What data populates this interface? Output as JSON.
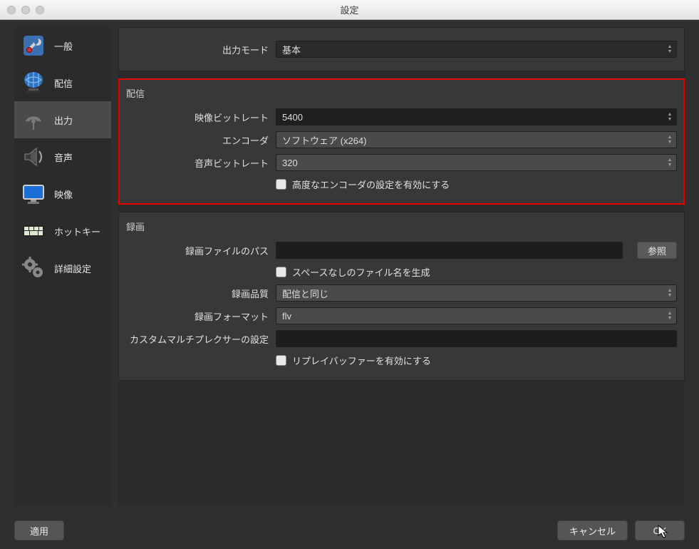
{
  "window": {
    "title": "設定"
  },
  "sidebar": {
    "items": [
      {
        "label": "一般"
      },
      {
        "label": "配信"
      },
      {
        "label": "出力"
      },
      {
        "label": "音声"
      },
      {
        "label": "映像"
      },
      {
        "label": "ホットキー"
      },
      {
        "label": "詳細設定"
      }
    ]
  },
  "output_mode": {
    "label": "出力モード",
    "value": "基本"
  },
  "streaming": {
    "title": "配信",
    "video_bitrate_label": "映像ビットレート",
    "video_bitrate_value": "5400",
    "encoder_label": "エンコーダ",
    "encoder_value": "ソフトウェア (x264)",
    "audio_bitrate_label": "音声ビットレート",
    "audio_bitrate_value": "320",
    "advanced_encoder_checkbox": "高度なエンコーダの設定を有効にする"
  },
  "recording": {
    "title": "録画",
    "path_label": "録画ファイルのパス",
    "path_value": "",
    "browse_label": "参照",
    "no_space_checkbox": "スペースなしのファイル名を生成",
    "quality_label": "録画品質",
    "quality_value": "配信と同じ",
    "format_label": "録画フォーマット",
    "format_value": "flv",
    "muxer_label": "カスタムマルチプレクサーの設定",
    "muxer_value": "",
    "replay_buffer_checkbox": "リプレイバッファーを有効にする"
  },
  "footer": {
    "apply": "適用",
    "cancel": "キャンセル",
    "ok": "OK"
  }
}
